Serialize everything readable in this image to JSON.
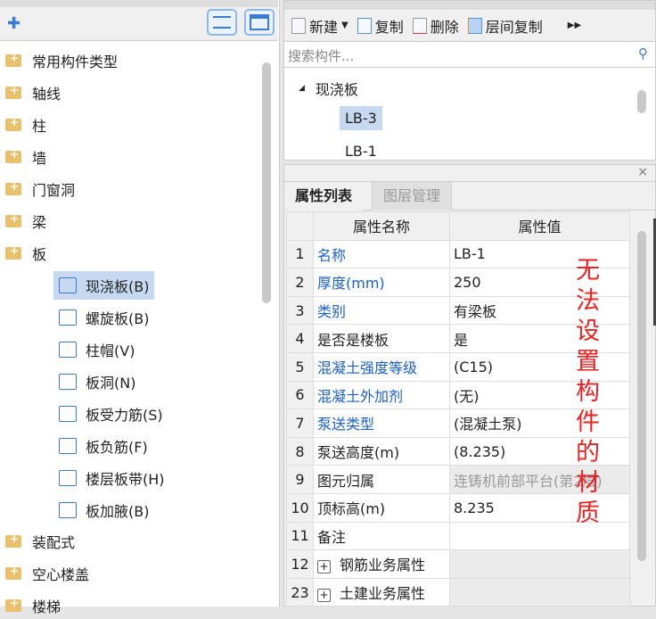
{
  "left": {
    "items": [
      "常用构件类型",
      "轴线",
      "柱",
      "墙",
      "门窗洞",
      "梁",
      "板"
    ],
    "subitems": [
      "现浇板(B)",
      "螺旋板(B)",
      "柱帽(V)",
      "板洞(N)",
      "板受力筋(S)",
      "板负筋(F)",
      "楼层板带(H)",
      "板加腋(B)"
    ],
    "selected_sub": "现浇板(B)",
    "items2": [
      "装配式",
      "空心楼盖",
      "楼梯"
    ]
  },
  "toolbar": {
    "new": "新建",
    "copy": "复制",
    "delete": "删除",
    "floor_copy": "层间复制"
  },
  "search": {
    "placeholder": "搜索构件..."
  },
  "tree": {
    "group": "现浇板",
    "items": [
      "LB-3",
      "LB-1"
    ],
    "selected": "LB-3"
  },
  "props": {
    "tabs": [
      "属性列表",
      "图层管理"
    ],
    "active_tab": "属性列表",
    "close": "×",
    "headers": [
      "属性名称",
      "属性值"
    ],
    "rows": [
      {
        "n": "1",
        "name": "名称",
        "value": "LB-1"
      },
      {
        "n": "2",
        "name": "厚度(mm)",
        "value": "250"
      },
      {
        "n": "3",
        "name": "类别",
        "value": "有梁板"
      },
      {
        "n": "4",
        "name": "是否是楼板",
        "value": "是"
      },
      {
        "n": "5",
        "name": "混凝土强度等级",
        "value": "(C15)"
      },
      {
        "n": "6",
        "name": "混凝土外加剂",
        "value": "(无)"
      },
      {
        "n": "7",
        "name": "泵送类型",
        "value": "(混凝土泵)"
      },
      {
        "n": "8",
        "name": "泵送高度(m)",
        "value": "(8.235)"
      },
      {
        "n": "9",
        "name": "图元归属",
        "value": "连铸机前部平台(第2层)"
      },
      {
        "n": "10",
        "name": "顶标高(m)",
        "value": "8.235"
      },
      {
        "n": "11",
        "name": "备注",
        "value": ""
      },
      {
        "n": "12",
        "name": "钢筋业务属性",
        "value": ""
      },
      {
        "n": "23",
        "name": "土建业务属性",
        "value": ""
      }
    ]
  },
  "annotation": "无法设置构件的材质",
  "colors": {
    "accent": "#1a5fd6",
    "annotation": "#f02020",
    "selection": "#c6d9f1"
  }
}
